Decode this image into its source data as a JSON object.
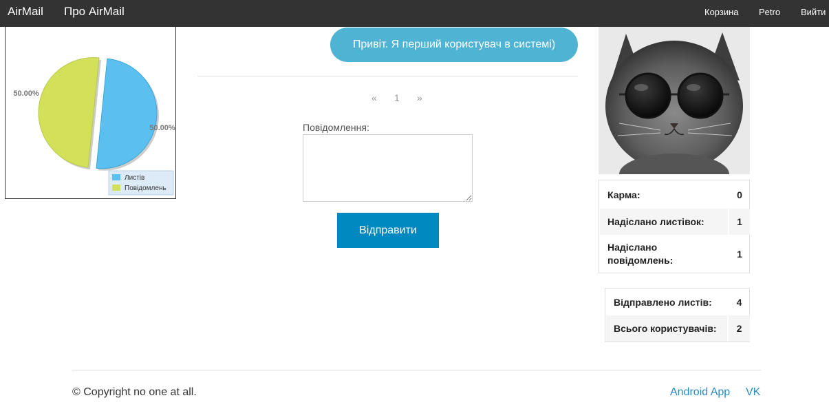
{
  "navbar": {
    "brand": "AirMail",
    "about": "Про AirMail",
    "cart": "Корзина",
    "user": "Petro",
    "logout": "Вийти"
  },
  "chart_data": {
    "type": "pie",
    "categories": [
      "Листів",
      "Повідомлень"
    ],
    "values": [
      50,
      50
    ],
    "value_labels": [
      "50.00%",
      "50.00%"
    ],
    "colors": [
      "#5bc0ef",
      "#d2e05a"
    ],
    "legend": "bottom-right"
  },
  "message": {
    "bubble_text": "Привіт. Я перший користувач в системі)"
  },
  "pager": {
    "prev": "«",
    "page": "1",
    "next": "»"
  },
  "form": {
    "label": "Повідомлення:",
    "value": "",
    "send_label": "Відправити"
  },
  "profile_stats": [
    {
      "label": "Карма:",
      "value": "0"
    },
    {
      "label": "Надіслано листівок:",
      "value": "1"
    },
    {
      "label": "Надіслано повідомлень:",
      "value": "1"
    }
  ],
  "global_stats": [
    {
      "label": "Відправлено листів:",
      "value": "4"
    },
    {
      "label": "Всього користувачів:",
      "value": "2"
    }
  ],
  "footer": {
    "copyright": "© Copyright no one at all.",
    "android": "Android App",
    "vk": "VK"
  }
}
